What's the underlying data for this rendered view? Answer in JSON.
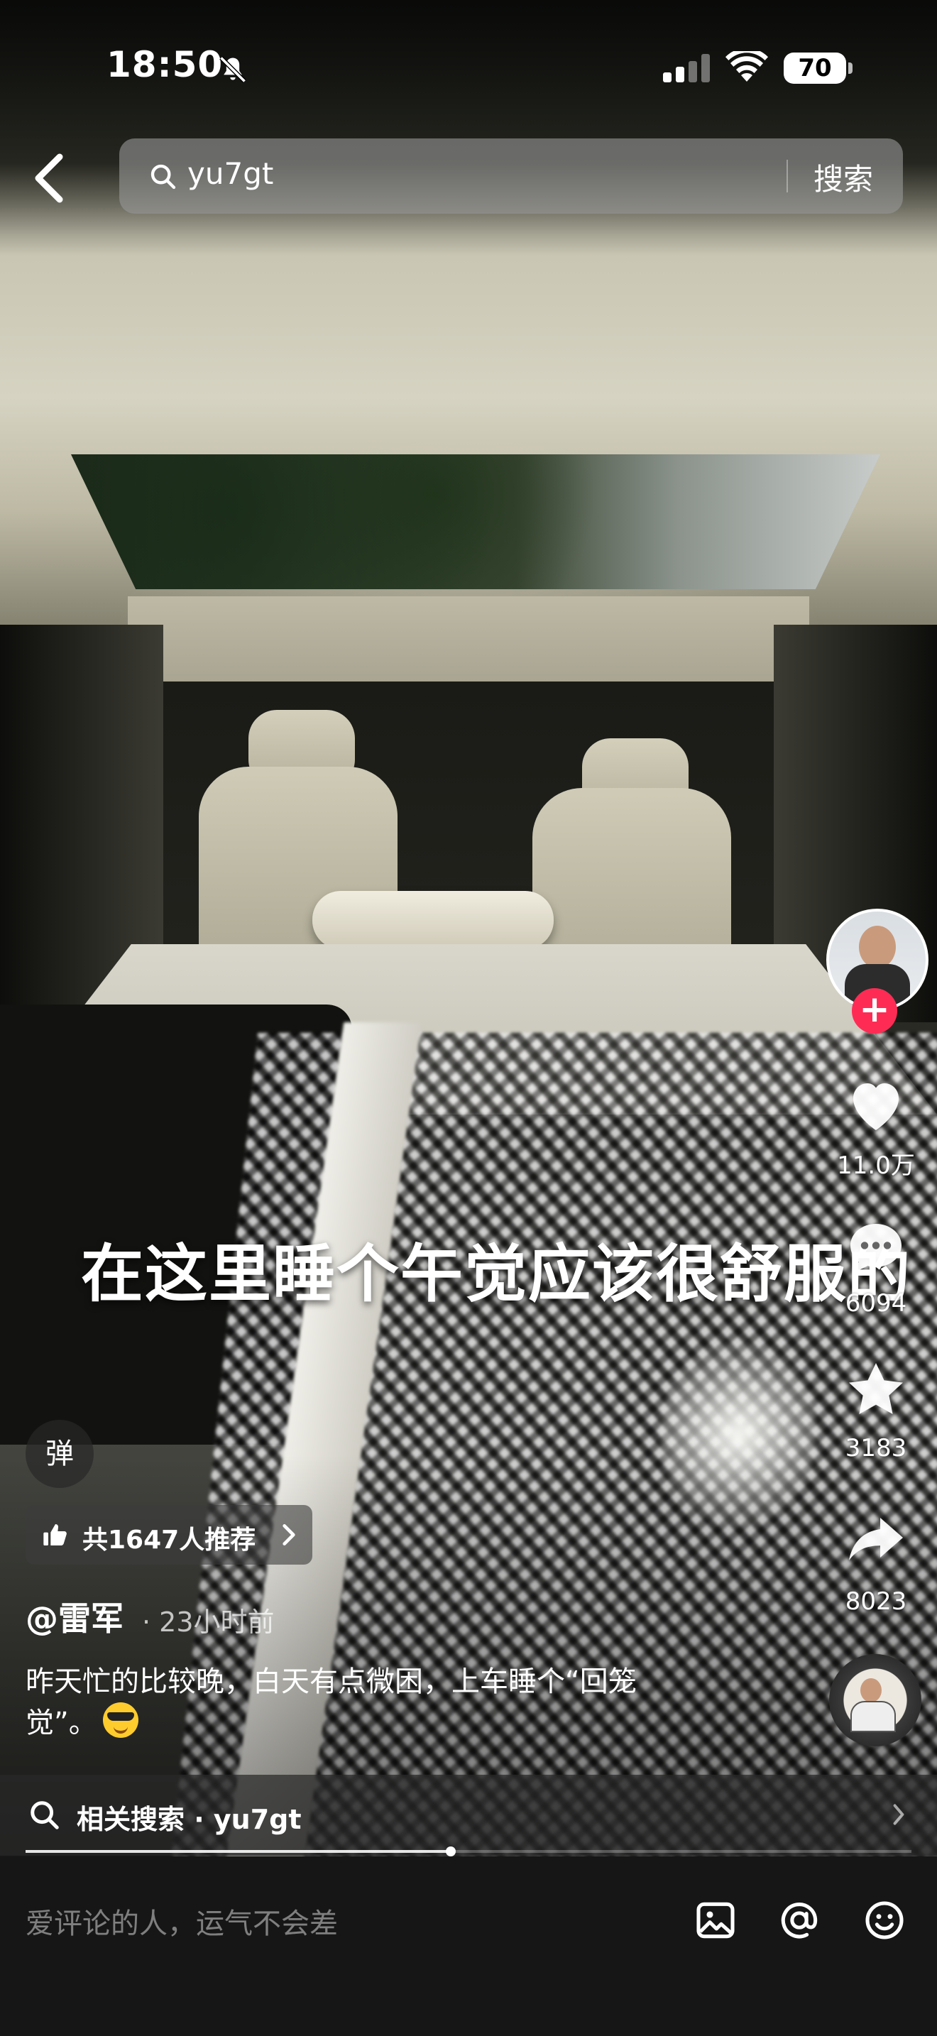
{
  "status_bar": {
    "time": "18:50",
    "battery": "70"
  },
  "search": {
    "query": "yu7gt",
    "button_label": "搜索"
  },
  "video": {
    "caption": "在这里睡个午觉应该很舒服的",
    "progress": 0.48
  },
  "actions": {
    "likes": "11.0万",
    "comments": "6094",
    "favorites": "3183",
    "shares": "8023"
  },
  "left": {
    "danmu_label": "弹",
    "recommend_text": "共1647人推荐",
    "author": "@雷军",
    "time_ago": "· 23小时前",
    "description_line1": "昨天忙的比较晚，白天有点微困，上车睡个“回笼",
    "description_line2": "觉”。"
  },
  "related_search": {
    "label": "相关搜索 · yu7gt"
  },
  "comment_bar": {
    "placeholder": "爱评论的人，运气不会差"
  },
  "icons": {
    "accent": "#fe2c55"
  }
}
